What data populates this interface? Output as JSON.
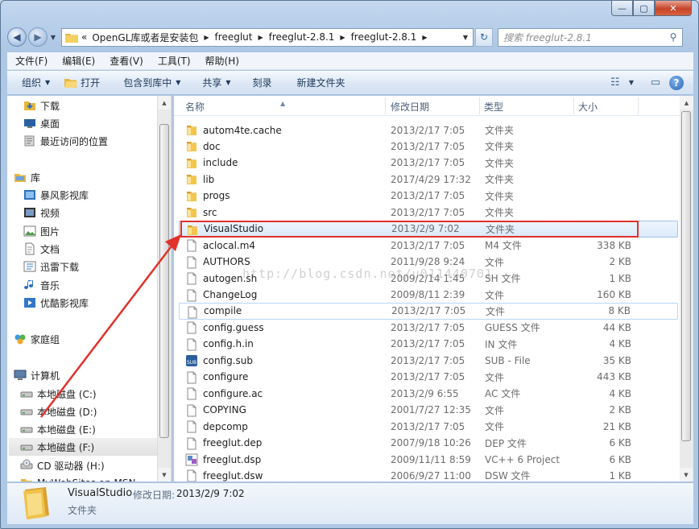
{
  "window": {
    "caption_min": "—",
    "caption_max": "▢",
    "caption_close": "✕"
  },
  "nav": {
    "prefix": "«",
    "breadcrumbs": [
      "OpenGL库或者是安装包",
      "freeglut",
      "freeglut-2.8.1",
      "freeglut-2.8.1"
    ],
    "search_placeholder": "搜索 freeglut-2.8.1"
  },
  "menu": [
    "文件(F)",
    "编辑(E)",
    "查看(V)",
    "工具(T)",
    "帮助(H)"
  ],
  "toolbar": {
    "organize": "组织",
    "open": "打开",
    "include_in_library": "包含到库中",
    "share": "共享",
    "burn": "刻录",
    "new_folder": "新建文件夹"
  },
  "sidebar": {
    "items": [
      {
        "label": "下载",
        "icon": "download-folder-icon"
      },
      {
        "label": "桌面",
        "icon": "desktop-icon"
      },
      {
        "label": "最近访问的位置",
        "icon": "recent-places-icon"
      },
      {
        "label": "库",
        "icon": "library-icon"
      },
      {
        "label": "暴风影视库",
        "icon": "video-library-icon"
      },
      {
        "label": "视频",
        "icon": "video-icon"
      },
      {
        "label": "图片",
        "icon": "pictures-icon"
      },
      {
        "label": "文档",
        "icon": "documents-icon"
      },
      {
        "label": "迅雷下载",
        "icon": "thunder-download-icon"
      },
      {
        "label": "音乐",
        "icon": "music-icon"
      },
      {
        "label": "优酷影视库",
        "icon": "youku-library-icon"
      },
      {
        "label": "家庭组",
        "icon": "homegroup-icon"
      },
      {
        "label": "计算机",
        "icon": "computer-icon"
      },
      {
        "label": "本地磁盘 (C:)",
        "icon": "drive-icon"
      },
      {
        "label": "本地磁盘 (D:)",
        "icon": "drive-icon"
      },
      {
        "label": "本地磁盘 (E:)",
        "icon": "drive-icon"
      },
      {
        "label": "本地磁盘 (F:)",
        "icon": "drive-icon"
      },
      {
        "label": "CD 驱动器 (H:)",
        "icon": "cd-drive-icon"
      },
      {
        "label": "MyWebSites on MSN",
        "icon": "network-folder-icon"
      }
    ]
  },
  "columns": {
    "name": "名称",
    "date": "修改日期",
    "type": "类型",
    "size": "大小"
  },
  "files": [
    {
      "name": "autom4te.cache",
      "date": "2013/2/17 7:05",
      "type": "文件夹",
      "size": "",
      "icon": "folder"
    },
    {
      "name": "doc",
      "date": "2013/2/17 7:05",
      "type": "文件夹",
      "size": "",
      "icon": "folder"
    },
    {
      "name": "include",
      "date": "2013/2/17 7:05",
      "type": "文件夹",
      "size": "",
      "icon": "folder"
    },
    {
      "name": "lib",
      "date": "2017/4/29 17:32",
      "type": "文件夹",
      "size": "",
      "icon": "folder"
    },
    {
      "name": "progs",
      "date": "2013/2/17 7:05",
      "type": "文件夹",
      "size": "",
      "icon": "folder"
    },
    {
      "name": "src",
      "date": "2013/2/17 7:05",
      "type": "文件夹",
      "size": "",
      "icon": "folder"
    },
    {
      "name": "VisualStudio",
      "date": "2013/2/9 7:02",
      "type": "文件夹",
      "size": "",
      "icon": "folder"
    },
    {
      "name": "aclocal.m4",
      "date": "2013/2/17 7:05",
      "type": "M4 文件",
      "size": "338 KB",
      "icon": "file"
    },
    {
      "name": "AUTHORS",
      "date": "2011/9/28 9:24",
      "type": "文件",
      "size": "2 KB",
      "icon": "file"
    },
    {
      "name": "autogen.sh",
      "date": "2009/2/14 1:45",
      "type": "SH 文件",
      "size": "1 KB",
      "icon": "file"
    },
    {
      "name": "ChangeLog",
      "date": "2009/8/11 2:39",
      "type": "文件",
      "size": "160 KB",
      "icon": "file"
    },
    {
      "name": "compile",
      "date": "2013/2/17 7:05",
      "type": "文件",
      "size": "8 KB",
      "icon": "file"
    },
    {
      "name": "config.guess",
      "date": "2013/2/17 7:05",
      "type": "GUESS 文件",
      "size": "44 KB",
      "icon": "file"
    },
    {
      "name": "config.h.in",
      "date": "2013/2/17 7:05",
      "type": "IN 文件",
      "size": "4 KB",
      "icon": "file"
    },
    {
      "name": "config.sub",
      "date": "2013/2/17 7:05",
      "type": "SUB - File",
      "size": "35 KB",
      "icon": "sub"
    },
    {
      "name": "configure",
      "date": "2013/2/17 7:05",
      "type": "文件",
      "size": "443 KB",
      "icon": "file"
    },
    {
      "name": "configure.ac",
      "date": "2013/2/9 6:55",
      "type": "AC 文件",
      "size": "4 KB",
      "icon": "file"
    },
    {
      "name": "COPYING",
      "date": "2001/7/27 12:35",
      "type": "文件",
      "size": "2 KB",
      "icon": "file"
    },
    {
      "name": "depcomp",
      "date": "2013/2/17 7:05",
      "type": "文件",
      "size": "21 KB",
      "icon": "file"
    },
    {
      "name": "freeglut.dep",
      "date": "2007/9/18 10:26",
      "type": "DEP 文件",
      "size": "6 KB",
      "icon": "file"
    },
    {
      "name": "freeglut.dsp",
      "date": "2009/11/11 8:59",
      "type": "VC++ 6 Project",
      "size": "6 KB",
      "icon": "vc"
    },
    {
      "name": "freeglut.dsw",
      "date": "2006/9/27 11:00",
      "type": "DSW 文件",
      "size": "1 KB",
      "icon": "file"
    }
  ],
  "details": {
    "name": "VisualStudio",
    "modified_label": "修改日期:",
    "modified_value": "2013/2/9 7:02",
    "type": "文件夹"
  },
  "watermark": "http://blog.csdn.net/u011440701",
  "colors": {
    "highlight_box": "#e0322b",
    "arrow": "#e0322b",
    "folder": "#e8b73c",
    "selection": "#dbeafb"
  }
}
